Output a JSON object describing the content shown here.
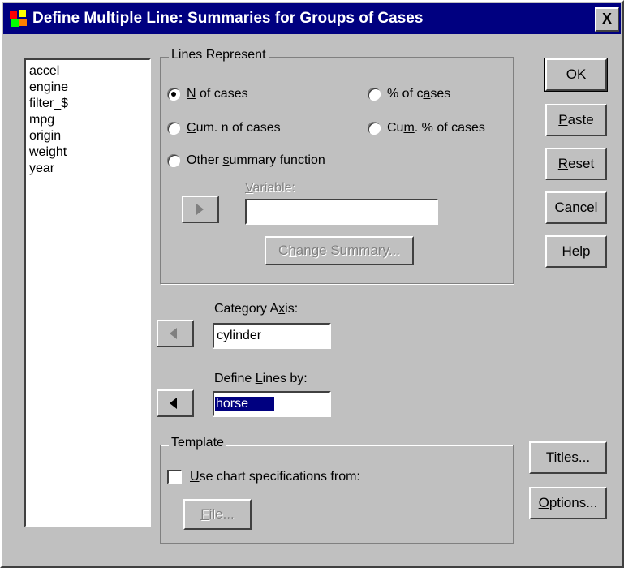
{
  "title": "Define Multiple Line: Summaries for Groups of Cases",
  "close_glyph": "X",
  "variables": [
    "accel",
    "engine",
    "filter_$",
    "mpg",
    "origin",
    "weight",
    "year"
  ],
  "lines_represent": {
    "legend": "Lines Represent",
    "options": [
      {
        "pre": "",
        "mnemonic": "N",
        "post": " of cases",
        "checked": true
      },
      {
        "pre": "% of c",
        "mnemonic": "a",
        "post": "ses",
        "checked": false
      },
      {
        "pre": "",
        "mnemonic": "C",
        "post": "um. n of cases",
        "checked": false
      },
      {
        "pre": "Cu",
        "mnemonic": "m",
        "post": ". % of cases",
        "checked": false
      },
      {
        "pre": "Other ",
        "mnemonic": "s",
        "post": "ummary function",
        "checked": false
      }
    ],
    "variable_label_pre": "",
    "variable_label_mnemonic": "V",
    "variable_label_post": "ariable:",
    "variable_value": "",
    "change_summary_pre": "C",
    "change_summary_mnemonic": "h",
    "change_summary_post": "ange Summary..."
  },
  "category_axis": {
    "label_pre": "Category A",
    "mnemonic": "x",
    "label_post": "is:",
    "value": "cylinder"
  },
  "define_lines_by": {
    "label_pre": "Define ",
    "mnemonic": "L",
    "label_post": "ines by:",
    "value": "horse"
  },
  "template": {
    "legend": "Template",
    "checkbox_mnemonic": "U",
    "checkbox_post": "se chart specifications from:",
    "file_mnemonic": "F",
    "file_post": "ile..."
  },
  "buttons": {
    "ok": "OK",
    "paste_m": "P",
    "paste_r": "aste",
    "reset_m": "R",
    "reset_r": "eset",
    "cancel": "Cancel",
    "help": "Help",
    "titles_m": "T",
    "titles_r": "itles...",
    "options_m": "O",
    "options_r": "ptions..."
  },
  "colors": {
    "titlebar": "#000080",
    "face": "#c0c0c0",
    "selection": "#000080"
  }
}
